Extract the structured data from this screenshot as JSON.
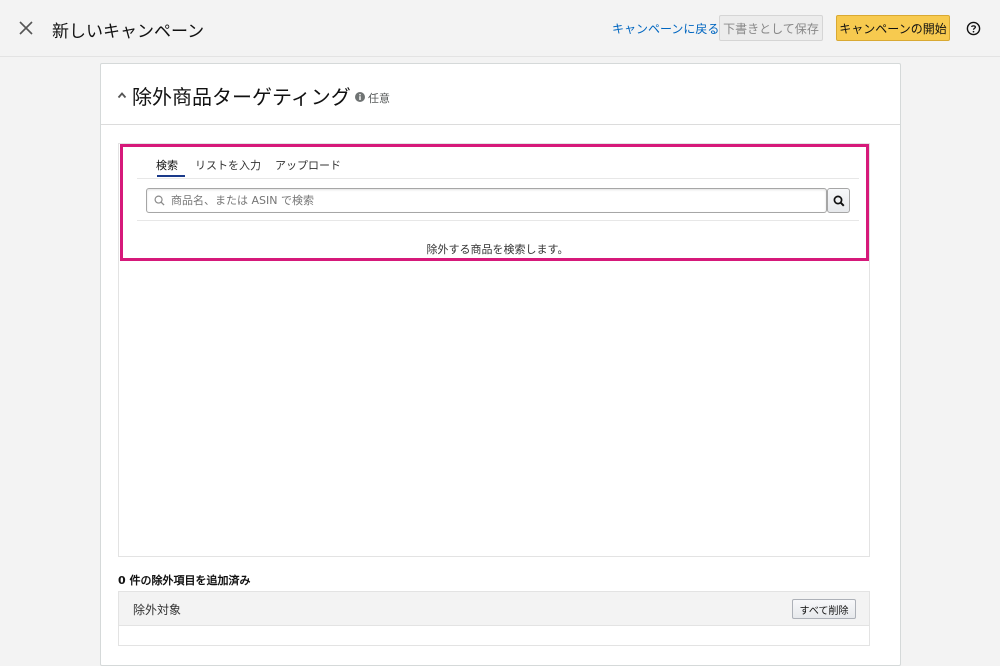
{
  "header": {
    "title": "新しいキャンペーン",
    "back_link": "キャンペーンに戻る",
    "save_draft_label": "下書きとして保存",
    "start_campaign_label": "キャンペーンの開始",
    "close_icon": "close-icon",
    "help_icon": "help-icon"
  },
  "section": {
    "title": "除外商品ターゲティング",
    "optional_label": "任意",
    "collapse_icon": "chevron-up-icon",
    "info_icon": "info-icon"
  },
  "tabs": [
    {
      "label": "検索",
      "active": true
    },
    {
      "label": "リストを入力",
      "active": false
    },
    {
      "label": "アップロード",
      "active": false
    }
  ],
  "search": {
    "placeholder": "商品名、または ASIN で検索",
    "value": "",
    "button_icon": "search-icon"
  },
  "empty_message": "除外する商品を検索します。",
  "excluded": {
    "count_label": "0 件の除外項目を追加済み",
    "column_header": "除外対象",
    "remove_all_label": "すべて削除",
    "rows": []
  },
  "colors": {
    "accent_link": "#0066c0",
    "primary_button": "#f7ca4f",
    "highlight_border": "#d6197a",
    "active_tab_underline": "#1a3a8a"
  }
}
